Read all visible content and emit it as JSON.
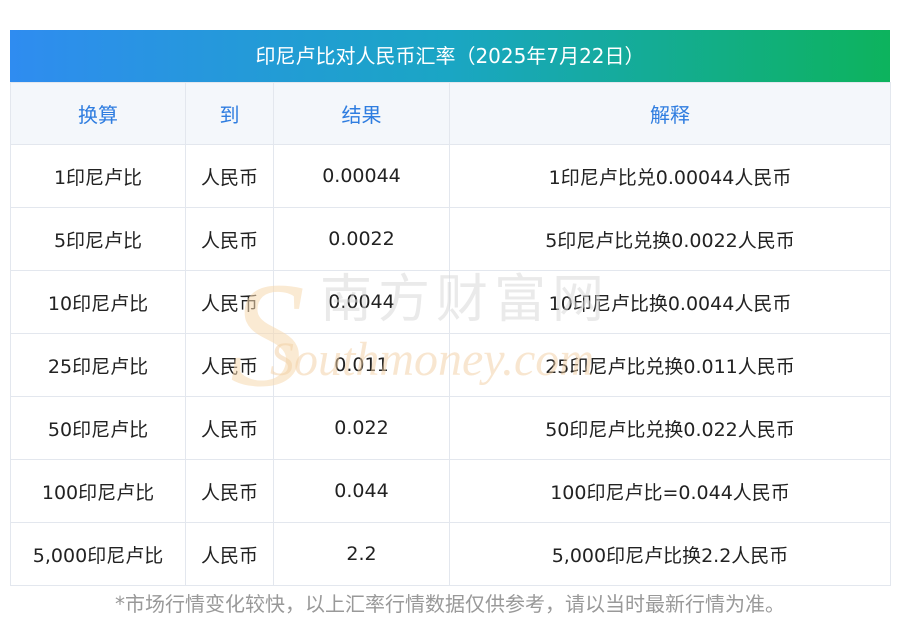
{
  "title": "印尼卢比对人民币汇率（2025年7月22日）",
  "headers": [
    "换算",
    "到",
    "结果",
    "解释"
  ],
  "rows": [
    {
      "from": "1印尼卢比",
      "to": "人民币",
      "result": "0.00044",
      "explain": "1印尼卢比兑0.00044人民币"
    },
    {
      "from": "5印尼卢比",
      "to": "人民币",
      "result": "0.0022",
      "explain": "5印尼卢比兑换0.0022人民币"
    },
    {
      "from": "10印尼卢比",
      "to": "人民币",
      "result": "0.0044",
      "explain": "10印尼卢比换0.0044人民币"
    },
    {
      "from": "25印尼卢比",
      "to": "人民币",
      "result": "0.011",
      "explain": "25印尼卢比兑换0.011人民币"
    },
    {
      "from": "50印尼卢比",
      "to": "人民币",
      "result": "0.022",
      "explain": "50印尼卢比兑换0.022人民币"
    },
    {
      "from": "100印尼卢比",
      "to": "人民币",
      "result": "0.044",
      "explain": "100印尼卢比=0.044人民币"
    },
    {
      "from": "5,000印尼卢比",
      "to": "人民币",
      "result": "2.2",
      "explain": "5,000印尼卢比换2.2人民币"
    }
  ],
  "note": "*市场行情变化较快，以上汇率行情数据仅供参考，请以当时最新行情为准。",
  "watermark": {
    "cn": "南方财富网",
    "en": "Southmoney.com"
  }
}
